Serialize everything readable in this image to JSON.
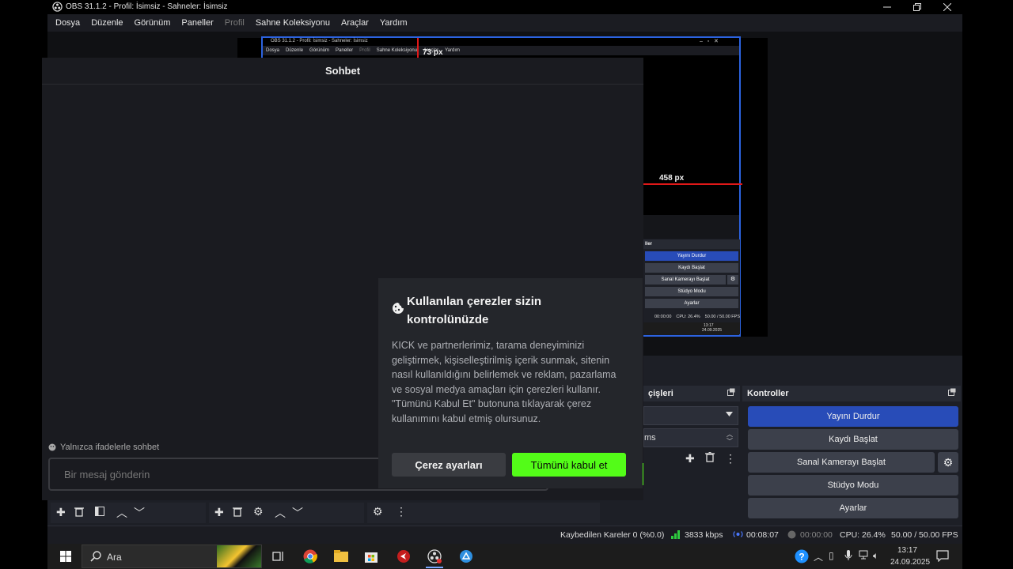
{
  "window": {
    "title": "OBS 31.1.2 - Profil: İsimsiz - Sahneler: İsimsiz",
    "controls": [
      "minimize",
      "restore",
      "close"
    ]
  },
  "menu": [
    "Dosya",
    "Düzenle",
    "Görünüm",
    "Paneller",
    "Profil",
    "Sahne Koleksiyonu",
    "Araçlar",
    "Yardım"
  ],
  "preview_overlay": {
    "inner_title": "OBS 31.1.2 - Profil: İsimsiz - Sahneler: İsimsiz",
    "inner_menu": [
      "Dosya",
      "Düzenle",
      "Görünüm",
      "Paneller",
      "Profil",
      "Sahne Koleksiyonu",
      "Araçlar",
      "Yardım"
    ],
    "measure_top": "73 px",
    "measure_right": "458 px",
    "inner_controls_header": "ller",
    "inner_buttons": [
      "Yayını Durdur",
      "Kaydı Başlat",
      "Sanal Kamerayı Başlat",
      "Stüdyo Modu",
      "Ayarlar"
    ],
    "inner_status": [
      "00:00:00",
      "CPU: 26.4%",
      "50.00 / 50.00 FPS"
    ],
    "inner_time": "13:17",
    "inner_date": "24.09.2025"
  },
  "chat": {
    "title": "Sohbet",
    "emote_only": "Yalnızca ifadelerle sohbet",
    "placeholder": "Bir mesaj gönderin",
    "send_label": "Sohbet"
  },
  "cookie": {
    "title": "Kullanılan çerezler sizin kontrolünüzde",
    "body": "KICK ve partnerlerimiz, tarama deneyiminizi geliştirmek, kişiselleştirilmiş içerik sunmak, sitenin nasıl kullanıldığını belirlemek ve reklam, pazarlama ve sosyal medya amaçları için çerezleri kullanır. \"Tümünü Kabul Et\" butonuna tıklayarak çerez kullanımını kabul etmiş olursunuz.",
    "settings_button": "Çerez ayarları",
    "accept_button": "Tümünü kabul et"
  },
  "docks": {
    "audio_header": "çişleri",
    "audio_row2": "ms",
    "controls_header": "Kontroller",
    "controls": [
      "Yayını Durdur",
      "Kaydı Başlat",
      "Sanal Kamerayı Başlat",
      "Stüdyo Modu",
      "Ayarlar"
    ]
  },
  "status": {
    "dropped": "Kaybedilen Kareler 0 (%0.0)",
    "bitrate": "3833 kbps",
    "stream_time": "00:08:07",
    "rec_time": "00:00:00",
    "cpu": "CPU: 26.4%",
    "fps": "50.00 / 50.00 FPS"
  },
  "taskbar": {
    "search": "Ara",
    "time": "13:17",
    "date": "24.09.2025"
  },
  "colors": {
    "accent_blue": "#284cb8",
    "kick_green": "#53fc18",
    "measure_red": "#e01818"
  }
}
